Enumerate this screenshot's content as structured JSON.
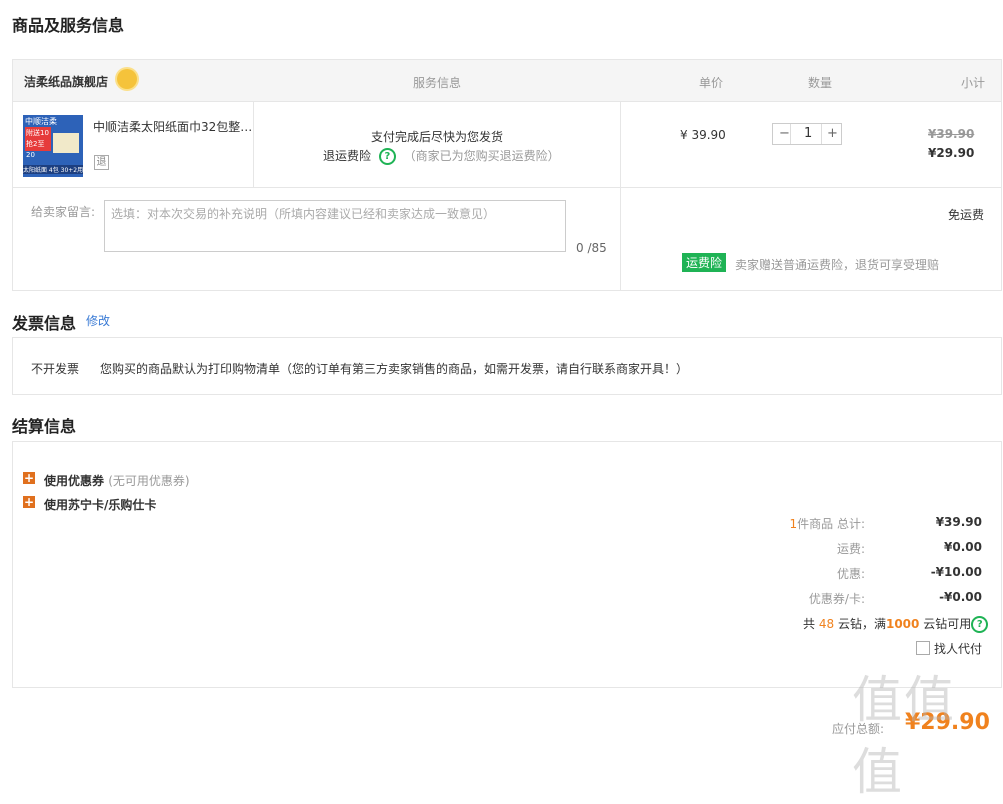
{
  "sections": {
    "goods_title": "商品及服务信息",
    "invoice_title": "发票信息",
    "invoice_edit": "修改",
    "settle_title": "结算信息"
  },
  "goods_table": {
    "store_name": "洁柔纸品旗舰店",
    "col_service": "服务信息",
    "col_price": "单价",
    "col_qty": "数量",
    "col_subtotal": "小计"
  },
  "product": {
    "name": "中顺洁柔太阳纸面巾32包整…",
    "return_tag": "退",
    "service_line1": "支付完成后尽快为您发货",
    "service_line2": "退运费险",
    "service_note": "（商家已为您购买退运费险）",
    "unit_price": "¥ 39.90",
    "quantity": "1",
    "qty_minus": "−",
    "qty_plus": "+",
    "subtotal_original": "¥39.90",
    "subtotal_final": "¥29.90",
    "image_text": {
      "brand": "中顺洁柔",
      "promo1": "附送10",
      "promo2": "抢2至20",
      "bottom": "太阳纸面 4包 30+2用"
    }
  },
  "remark": {
    "label": "给卖家留言:",
    "placeholder": "选填：对本次交易的补充说明（所填内容建议已经和卖家达成一致意见）",
    "count": "0 /85",
    "shipping": "免运费",
    "insurance_tag": "运费险",
    "insurance_text": "卖家赠送普通运费险，退货可享受理赔"
  },
  "invoice": {
    "type": "不开发票",
    "desc": "您购买的商品默认为打印购物清单（您的订单有第三方卖家销售的商品，如需开发票，请自行联系商家开具！）"
  },
  "settle": {
    "coupon_label": "使用优惠券",
    "coupon_note": "(无可用优惠券)",
    "card_label": "使用苏宁卡/乐购仕卡",
    "item_count": "1",
    "item_label": "件商品 总计:",
    "total_value": "¥39.90",
    "shipping_label": "运费:",
    "shipping_value": "¥0.00",
    "discount_label": "优惠:",
    "discount_value": "-¥10.00",
    "coupon_card_label": "优惠券/卡:",
    "coupon_card_value": "-¥0.00",
    "diamond_prefix": "共",
    "diamond_count": "48",
    "diamond_mid": "云钻，满",
    "diamond_threshold": "1000",
    "diamond_suffix": "云钻可用",
    "proxy_pay": "找人代付",
    "payable_label": "应付总额:",
    "payable_value": "¥29.90"
  },
  "watermark": "值值值",
  "colors": {
    "accent_orange": "#f0821e",
    "green": "#1fb355",
    "link_blue": "#3a7bd5"
  }
}
